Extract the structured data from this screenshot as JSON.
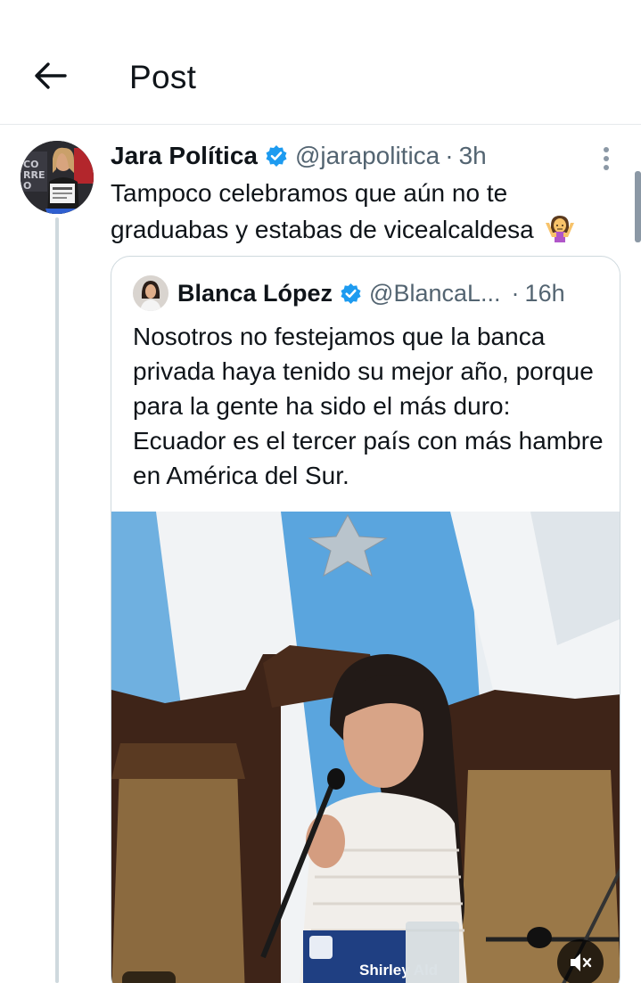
{
  "header": {
    "title": "Post",
    "back_icon": "arrow-left-icon"
  },
  "tweet": {
    "display_name": "Jara Política",
    "handle": "@jarapolitica",
    "separator": "·",
    "time": "3h",
    "text": "Tampoco celebramos que aún no te graduabas y estabas de vicealcaldesa",
    "emoji": "woman-shrugging",
    "verified_color": "#1d9bf0"
  },
  "quote": {
    "display_name": "Blanca López",
    "handle": "@BlancaL...",
    "separator": "·",
    "time": "16h",
    "text": "Nosotros no festejamos que la banca privada haya tenido su mejor año, porque para la gente ha sido el más duro: Ecuador es el tercer país con más hambre en América del Sur.",
    "media": {
      "nameplate": "Shirley Ald",
      "mute_icon": "speaker-muted-icon"
    }
  },
  "colors": {
    "text": "#0f1419",
    "secondary": "#536471",
    "border": "#cfd9de",
    "accent": "#1d9bf0"
  }
}
